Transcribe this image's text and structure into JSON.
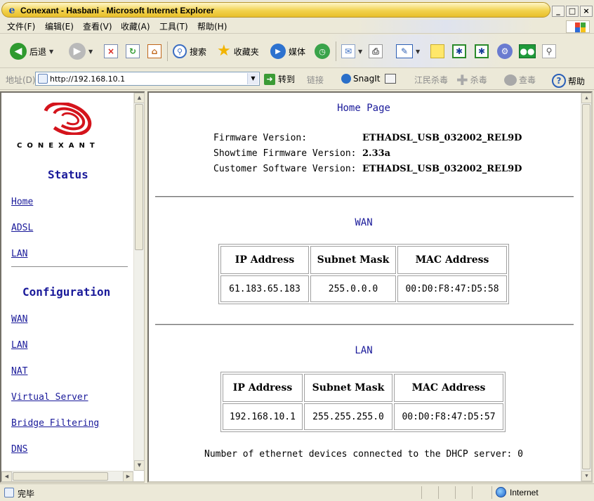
{
  "window": {
    "title": "Conexant - Hasbani - Microsoft Internet Explorer",
    "min": "_",
    "max": "□",
    "close": "×"
  },
  "menu": [
    "文件(F)",
    "编辑(E)",
    "查看(V)",
    "收藏(A)",
    "工具(T)",
    "帮助(H)"
  ],
  "toolbar": {
    "back": "后退",
    "search": "搜索",
    "favorites": "收藏夹",
    "media": "媒体"
  },
  "address": {
    "label": "地址(D)",
    "url": "http://192.168.10.1",
    "go": "转到",
    "links": "链接",
    "snagit": "SnagIt",
    "jiangmin": "江民杀毒",
    "antivirus": "杀毒",
    "check": "查毒",
    "help": "帮助"
  },
  "nav": {
    "logo_text": "CONEXANT",
    "status_heading": "Status",
    "status_links": [
      "Home",
      "ADSL",
      "LAN"
    ],
    "config_heading": "Configuration",
    "config_links": [
      "WAN",
      "LAN",
      "NAT",
      "Virtual Server",
      "Bridge Filtering",
      "DNS"
    ]
  },
  "main": {
    "title": "Home Page",
    "firmware": [
      {
        "label": "Firmware Version:",
        "value": "ETHADSL_USB_032002_REL9D"
      },
      {
        "label": "Showtime Firmware Version:",
        "value": "2.33a"
      },
      {
        "label": "Customer Software Version:",
        "value": "ETHADSL_USB_032002_REL9D"
      }
    ],
    "wan": {
      "title": "WAN",
      "headers": [
        "IP Address",
        "Subnet Mask",
        "MAC Address"
      ],
      "row": [
        "61.183.65.183",
        "255.0.0.0",
        "00:D0:F8:47:D5:58"
      ]
    },
    "lan": {
      "title": "LAN",
      "headers": [
        "IP Address",
        "Subnet Mask",
        "MAC Address"
      ],
      "row": [
        "192.168.10.1",
        "255.255.255.0",
        "00:D0:F8:47:D5:57"
      ]
    },
    "dhcp_text": "Number of ethernet devices connected to the DHCP server: 0"
  },
  "status": {
    "text": "完毕",
    "zone": "Internet"
  },
  "colors": {
    "link": "#1a1a9a",
    "title_bar": "#f2d24e",
    "logo_red": "#d4141c"
  }
}
